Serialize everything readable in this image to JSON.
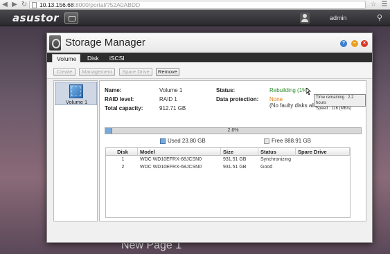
{
  "browser": {
    "url_host": "10.13.156.68",
    "url_rest": ":8000/portal/?52A0ABDD"
  },
  "topbar": {
    "logo": "asustor",
    "username": "admin"
  },
  "desktop": {
    "new_page_label": "New Page 1"
  },
  "window": {
    "title": "Storage Manager",
    "tabs": [
      "Volume",
      "Disk",
      "iSCSI"
    ],
    "toolbar": {
      "create": "Create",
      "management": "Management",
      "spare_drive": "Spare Drive",
      "remove": "Remove"
    },
    "sidebar": {
      "volume_name": "Volume 1"
    },
    "details": {
      "name_label": "Name:",
      "name_value": "Volume 1",
      "raid_label": "RAID level:",
      "raid_value": "RAID 1",
      "capacity_label": "Total capacity:",
      "capacity_value": "912.71 GB",
      "status_label": "Status:",
      "status_value": "Rebuilding (1%)",
      "protection_label": "Data protection:",
      "protection_value": "None",
      "protection_note": "(No faulty disks allo"
    },
    "tooltip": {
      "line1": "Time remaining : 2.2 hours",
      "line2": "Speed : 116 (MB/s)"
    },
    "usage": {
      "percent_label": "2.6%",
      "percent": 2.6,
      "used": "Used 23.80 GB",
      "free": "Free 888.91 GB"
    },
    "table": {
      "headers": [
        "Disk",
        "Model",
        "Size",
        "Status",
        "Spare Drive"
      ],
      "rows": [
        {
          "disk": "1",
          "model": "WDC WD10EFRX-68JCSN0",
          "size": "931.51 GB",
          "status": "Synchronizing",
          "spare": ""
        },
        {
          "disk": "2",
          "model": "WDC WD10EFRX-68JCSN0",
          "size": "931.51 GB",
          "status": "Good",
          "spare": ""
        }
      ]
    }
  },
  "colors": {
    "status_green": "#2e8b2e",
    "status_orange": "#e07c18",
    "usage_fill": "#7aa8d8"
  }
}
